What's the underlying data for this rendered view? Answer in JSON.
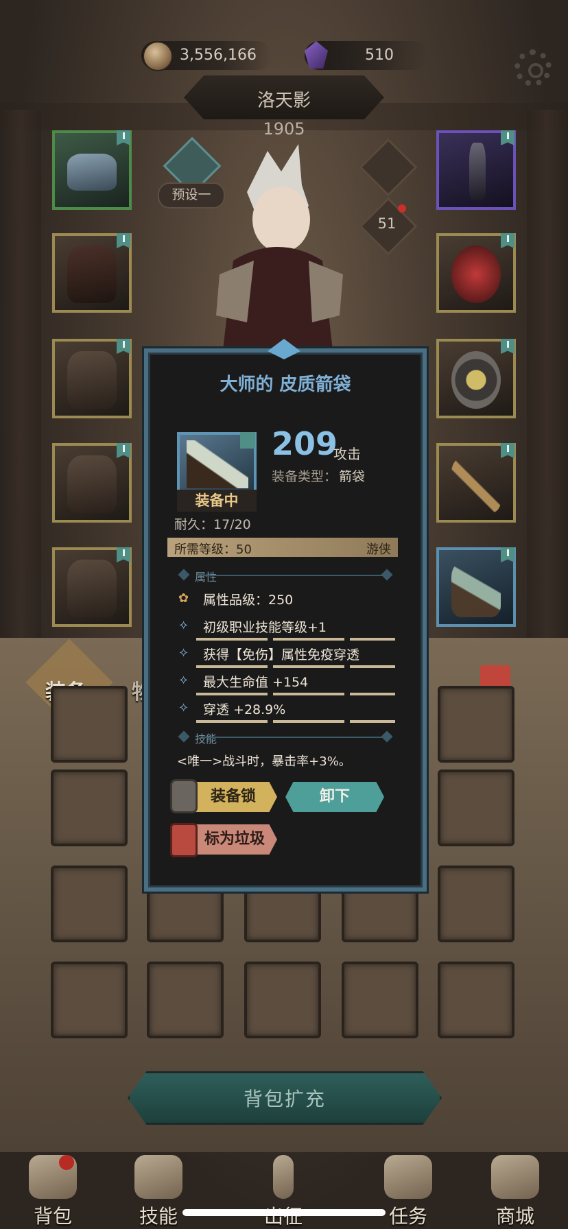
{
  "currency": {
    "gold_value": "3,556,166",
    "gem_value": "510",
    "gold_icon": "coin-icon",
    "gem_icon": "gem-icon"
  },
  "character": {
    "name": "洛天影",
    "power": "1905",
    "preset_label": "预设一",
    "points_value": "51"
  },
  "item_popup": {
    "title": "大师的 皮质箭袋",
    "stat_value": "209",
    "stat_type": "攻击",
    "equip_type_label": "装备类型：",
    "equip_type_value": "箭袋",
    "equipped_label": "装备中",
    "durability": "耐久：17/20",
    "required_level": "所需等级：50",
    "class_name": "游侠",
    "section_attributes": "属性",
    "attributes": [
      "属性品级：250",
      "初级职业技能等级+1",
      "获得【免伤】属性免疫穿透",
      "最大生命值 +154",
      "穿透 +28.9%"
    ],
    "section_skills": "技能",
    "skill_text": "<唯一>战斗时，暴击率+3%。",
    "lock_button": "装备锁",
    "unequip_button": "卸下",
    "trash_button": "标为垃圾"
  },
  "inventory": {
    "tab_equipment": "装备",
    "tab_items": "物品",
    "expand_button": "背包扩充"
  },
  "bottom_nav": {
    "items": [
      "背包",
      "技能",
      "出征",
      "任务",
      "商城"
    ]
  },
  "colors": {
    "popup_title": "#7fb0d6",
    "stat_value": "#8cc1e6",
    "equipped_text": "#e9c98a",
    "lock_button_bg": "#d2b25c",
    "unequip_button_bg": "#4e9e9a",
    "trash_button_bg": "#c98878",
    "slot_green": "#4e8a48",
    "slot_purple": "#6a52b8",
    "slot_blue": "#5d8fae",
    "slot_gold": "#9b8a52"
  }
}
